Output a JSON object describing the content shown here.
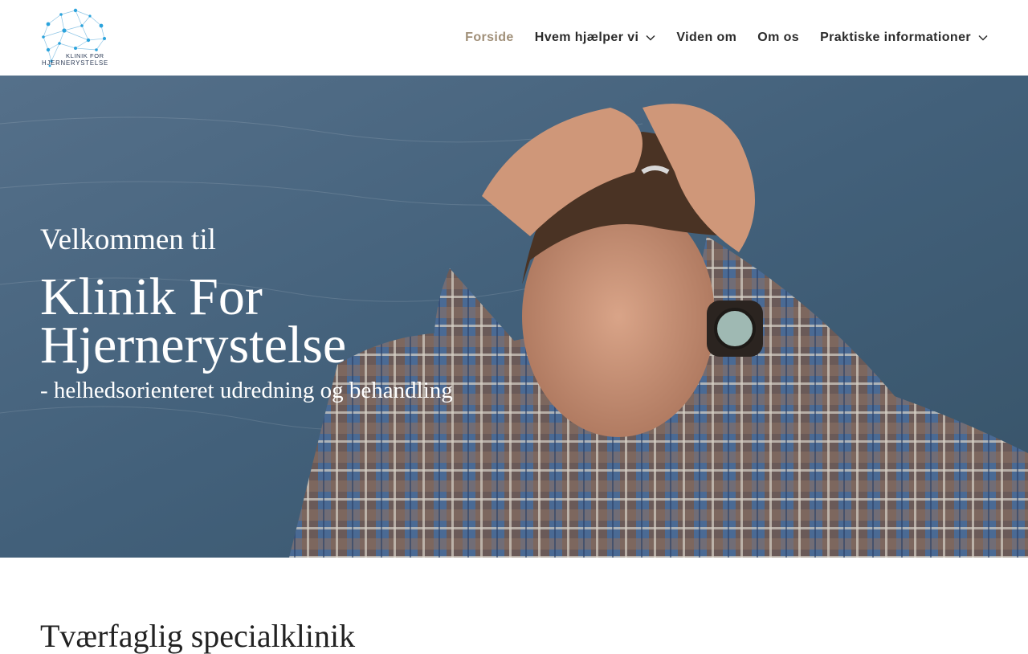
{
  "logo": {
    "line1": "KLINIK FOR",
    "line2": "HJERNERYSTELSE",
    "icon": "brain-network-icon",
    "colors": {
      "nodes": "#2ba3dc",
      "text": "#2b3a55"
    }
  },
  "nav": {
    "items": [
      {
        "label": "Forside",
        "active": true,
        "dropdown": false
      },
      {
        "label": "Hvem hjælper vi",
        "active": false,
        "dropdown": true
      },
      {
        "label": "Viden om",
        "active": false,
        "dropdown": false
      },
      {
        "label": "Om os",
        "active": false,
        "dropdown": false
      },
      {
        "label": "Praktiske informationer",
        "active": false,
        "dropdown": true
      }
    ],
    "colors": {
      "active": "#a08f78",
      "default": "#2b2b2b"
    }
  },
  "hero": {
    "welcome": "Velkommen til",
    "title": "Klinik For Hjernerystelse",
    "tagline": "- helhedsorienteret udredning og behandling"
  },
  "section": {
    "title": "Tværfaglig specialklinik"
  }
}
